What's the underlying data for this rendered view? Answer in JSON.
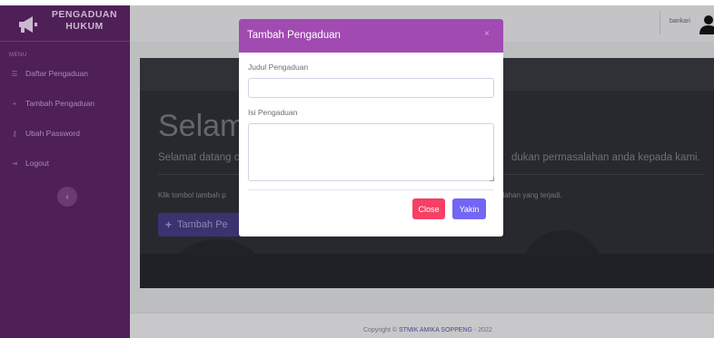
{
  "sidebar": {
    "brand_line1": "PENGADUAN",
    "brand_line2": "HUKUM",
    "menu_heading": "MENU",
    "items": [
      {
        "label": "Daftar Pengaduan",
        "icon": "list-icon"
      },
      {
        "label": "Tambah Pengaduan",
        "icon": "plus-icon"
      },
      {
        "label": "Ubah Password",
        "icon": "key-icon"
      },
      {
        "label": "Logout",
        "icon": "logout-icon"
      }
    ],
    "toggle_icon": "chevron-left-icon"
  },
  "topbar": {
    "username": "bankari",
    "user_icon": "user-icon"
  },
  "jumbotron": {
    "title": "Selam",
    "lead_part1": "Selamat datang c",
    "lead_part2": "dukan permasalahan anda kepada kami.",
    "text_part1": "Klik tombol tambah p",
    "text_part2": "alahan yang terjadi.",
    "button_label": "Tambah Pe"
  },
  "modal": {
    "title": "Tambah Pengaduan",
    "close_symbol": "×",
    "judul_label": "Judul Pengaduan",
    "judul_value": "",
    "isi_label": "Isi Pengaduan",
    "isi_value": "",
    "close_button": "Close",
    "confirm_button": "Yakin"
  },
  "footer": {
    "copyright_prefix": "Copyright © ",
    "copyright_org": "STMIK AMIKA SOPPENG",
    "copyright_suffix": " - 2022"
  },
  "colors": {
    "sidebar_bg": "#4f1f58",
    "modal_header": "#a14ab1",
    "close_button": "#f64066",
    "confirm_button": "#7366f3"
  }
}
